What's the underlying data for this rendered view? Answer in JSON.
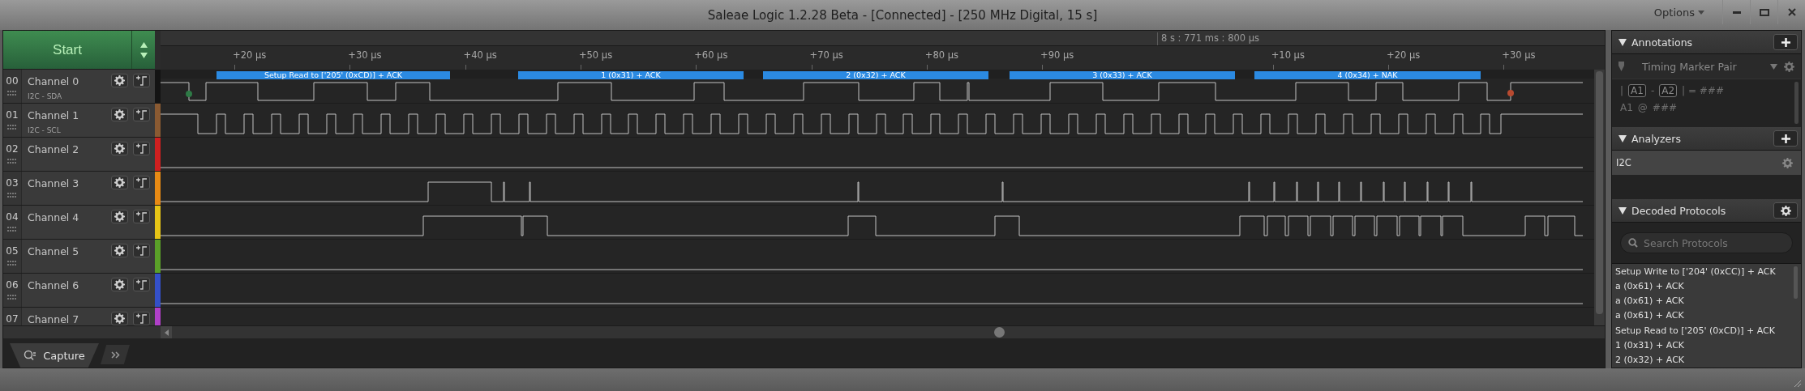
{
  "window": {
    "title": "Saleae Logic 1.2.28 Beta - [Connected] - [250 MHz Digital, 15 s]",
    "menu": "Options"
  },
  "start_button": {
    "label": "Start"
  },
  "timeline": {
    "marker": "8 s : 771 ms : 800 µs",
    "ticks": [
      "+20 µs",
      "+30 µs",
      "+40 µs",
      "+50 µs",
      "+60 µs",
      "+70 µs",
      "+80 µs",
      "+90 µs",
      "+10 µs",
      "+20 µs",
      "+30 µs"
    ]
  },
  "frames": [
    "Setup Read to ['205' (0xCD)] + ACK",
    "1 (0x31) + ACK",
    "2 (0x32) + ACK",
    "3 (0x33) + ACK",
    "4 (0x34) + NAK"
  ],
  "channels": [
    {
      "number": "00",
      "name": "Channel 0",
      "analyzer": "I2C - SDA",
      "color": "#141414"
    },
    {
      "number": "01",
      "name": "Channel 1",
      "analyzer": "I2C - SCL",
      "color": "#8a5a32"
    },
    {
      "number": "02",
      "name": "Channel 2",
      "color": "#d02020"
    },
    {
      "number": "03",
      "name": "Channel 3",
      "color": "#e88a14"
    },
    {
      "number": "04",
      "name": "Channel 4",
      "color": "#e6c416"
    },
    {
      "number": "05",
      "name": "Channel 5",
      "color": "#5aa028"
    },
    {
      "number": "06",
      "name": "Channel 6",
      "color": "#3450c8"
    },
    {
      "number": "07",
      "name": "Channel 7",
      "color": "#b040c8"
    }
  ],
  "bottom_tabs": [
    {
      "label": "Capture",
      "selected": true
    }
  ],
  "annotations": {
    "title": "Annotations",
    "marker_type": "Timing Marker Pair",
    "rows": [
      [
        {
          "kind": "plain",
          "text": "|"
        },
        {
          "kind": "tag",
          "text": "A1"
        },
        {
          "kind": "plain",
          "text": "-"
        },
        {
          "kind": "tag",
          "text": "A2"
        },
        {
          "kind": "plain",
          "text": "| = ###"
        }
      ],
      [
        {
          "kind": "plain",
          "text": "A1"
        },
        {
          "kind": "plain",
          "text": "@"
        },
        {
          "kind": "plain",
          "text": "###"
        }
      ]
    ]
  },
  "analyzers": {
    "title": "Analyzers",
    "items": [
      "I2C"
    ]
  },
  "decoded": {
    "title": "Decoded Protocols",
    "search_placeholder": "Search Protocols",
    "items": [
      "Setup Write to ['204' (0xCC)] + ACK",
      "a (0x61) + ACK",
      "a (0x61) + ACK",
      "a (0x61) + ACK",
      "Setup Read to ['205' (0xCD)] + ACK",
      "1 (0x31) + ACK",
      "2 (0x32) + ACK"
    ]
  }
}
